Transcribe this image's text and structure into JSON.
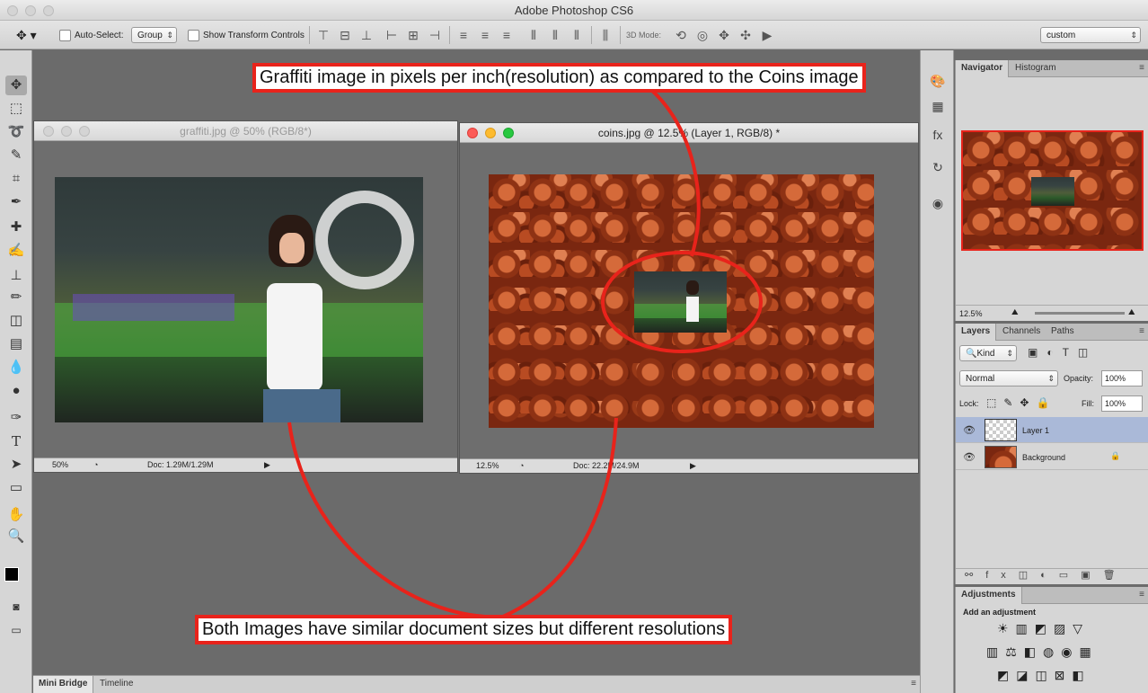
{
  "app": {
    "title": "Adobe Photoshop CS6"
  },
  "options_bar": {
    "auto_select_label": "Auto-Select:",
    "auto_select_value": "Group",
    "show_transform_label": "Show Transform Controls",
    "mode_3d_label": "3D Mode:",
    "workspace_value": "custom"
  },
  "tools": [
    "move-tool",
    "marquee-tool",
    "lasso-tool",
    "quick-select-tool",
    "crop-tool",
    "eyedropper-tool",
    "spot-heal-tool",
    "brush-tool",
    "clone-stamp-tool",
    "history-brush-tool",
    "eraser-tool",
    "gradient-tool",
    "blur-tool",
    "dodge-tool",
    "pen-tool",
    "type-tool",
    "path-select-tool",
    "rectangle-tool",
    "hand-tool",
    "zoom-tool"
  ],
  "doc1": {
    "title": "graffiti.jpg @ 50% (RGB/8*)",
    "zoom": "50%",
    "doc_info": "Doc: 1.29M/1.29M"
  },
  "doc2": {
    "title": "coins.jpg @ 12.5% (Layer 1, RGB/8) *",
    "zoom": "12.5%",
    "doc_info": "Doc: 22.2M/24.9M"
  },
  "navigator": {
    "tabs": [
      "Navigator",
      "Histogram"
    ],
    "zoom": "12.5%"
  },
  "layers_panel": {
    "tabs": [
      "Layers",
      "Channels",
      "Paths"
    ],
    "filter_kind": "Kind",
    "blend_mode": "Normal",
    "opacity_label": "Opacity:",
    "opacity_value": "100%",
    "lock_label": "Lock:",
    "fill_label": "Fill:",
    "fill_value": "100%",
    "layers": [
      {
        "name": "Layer 1",
        "selected": true
      },
      {
        "name": "Background",
        "selected": false,
        "locked": true
      }
    ]
  },
  "adjustments": {
    "tab": "Adjustments",
    "heading": "Add an adjustment"
  },
  "bottom_tabs": [
    "Mini Bridge",
    "Timeline"
  ],
  "annotations": {
    "top": "Graffiti image in pixels per inch(resolution) as compared to the Coins image",
    "bottom": "Both Images have similar document sizes but different resolutions"
  },
  "colors": {
    "annotation_red": "#e8231b",
    "selected_layer": "#aab9d8"
  }
}
